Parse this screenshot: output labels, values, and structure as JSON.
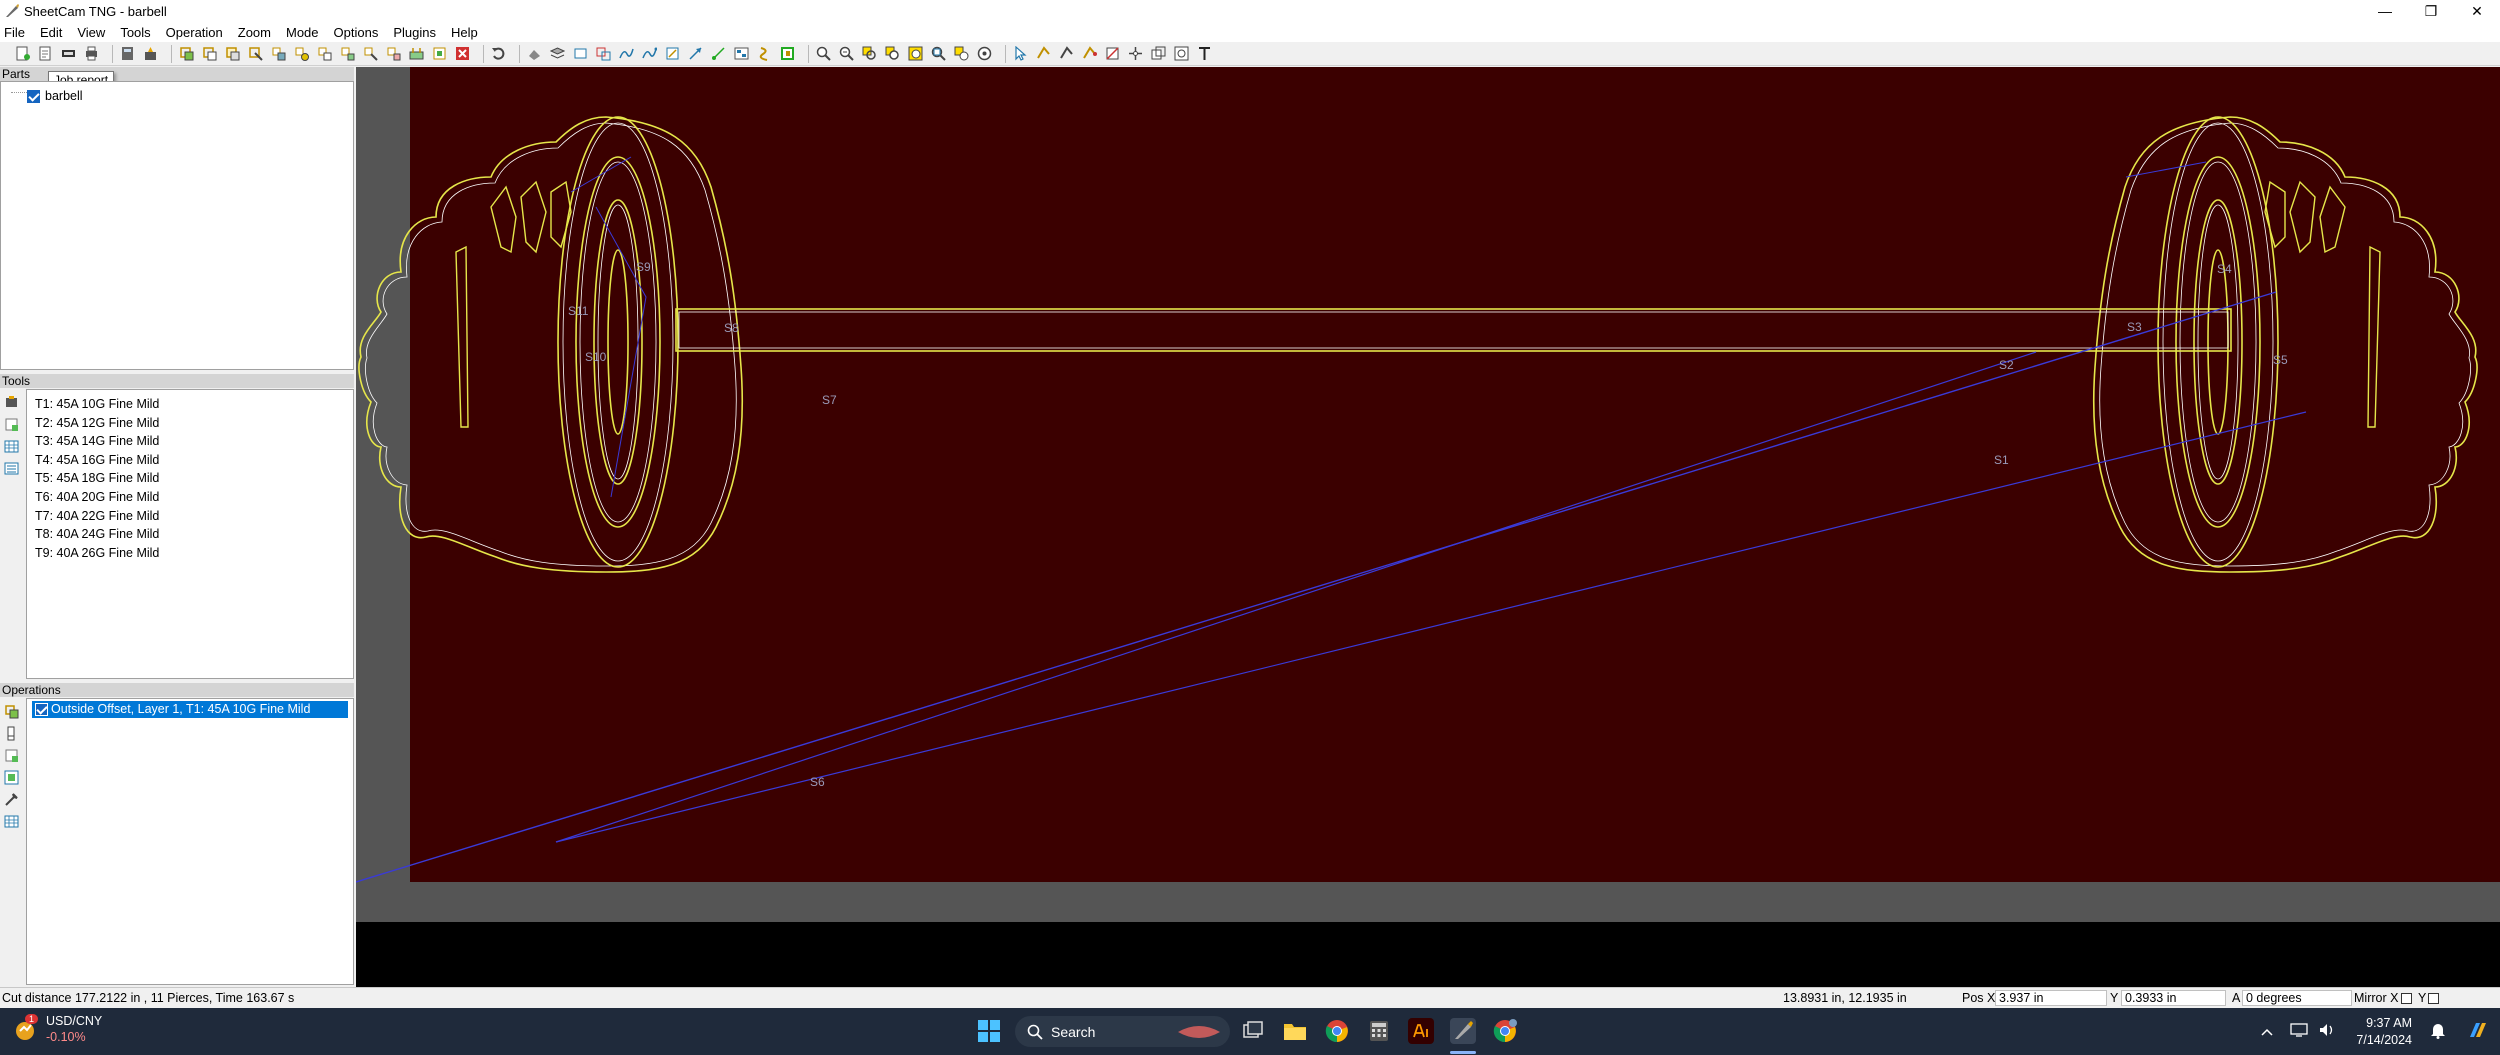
{
  "window": {
    "title": "SheetCam TNG - barbell",
    "minimize": "—",
    "maximize": "❐",
    "close": "✕"
  },
  "menu": [
    "File",
    "Edit",
    "View",
    "Tools",
    "Operation",
    "Zoom",
    "Mode",
    "Options",
    "Plugins",
    "Help"
  ],
  "tooltip": "Job report",
  "parts": {
    "header": "Parts",
    "items": [
      {
        "label": "barbell",
        "checked": true
      }
    ]
  },
  "tools": {
    "header": "Tools",
    "items": [
      "T1: 45A 10G Fine Mild",
      "T2: 45A 12G Fine Mild",
      "T3: 45A 14G Fine Mild",
      "T4: 45A 16G Fine Mild",
      "T5: 45A 18G Fine Mild",
      "T6: 40A 20G Fine Mild",
      "T7: 40A 22G Fine Mild",
      "T8: 40A 24G Fine Mild",
      "T9: 40A 26G Fine Mild"
    ]
  },
  "operations": {
    "header": "Operations",
    "items": [
      {
        "label": "Outside Offset, Layer 1, T1: 45A 10G Fine Mild",
        "checked": true,
        "selected": true
      }
    ]
  },
  "canvas": {
    "labels": [
      "S1",
      "S2",
      "S3",
      "S4",
      "S5",
      "S6",
      "S7",
      "S8",
      "S9",
      "S10",
      "S11"
    ],
    "colors": {
      "background": "#3b0000",
      "viewport": "#555555",
      "part_outline": "#ffffff",
      "toolpath": "#e6e64a",
      "rapid": "#3a3ad8",
      "label": "#9a9ab8"
    }
  },
  "status": {
    "cut_info": "Cut distance 177.2122 in , 11 Pierces, Time 163.67 s",
    "cursor": "13.8931 in, 12.1935 in",
    "pos_x_label": "Pos X",
    "pos_x": "3.937 in",
    "y_label": "Y",
    "pos_y": "0.3933 in",
    "a_label": "A",
    "angle": "0 degrees",
    "mirror_x": "Mirror X",
    "mirror_y": "Y"
  },
  "taskbar": {
    "ticker": "USD/CNY",
    "change": "-0.10%",
    "badge": "1",
    "search": "Search",
    "time": "9:37 AM",
    "date": "7/14/2024"
  }
}
